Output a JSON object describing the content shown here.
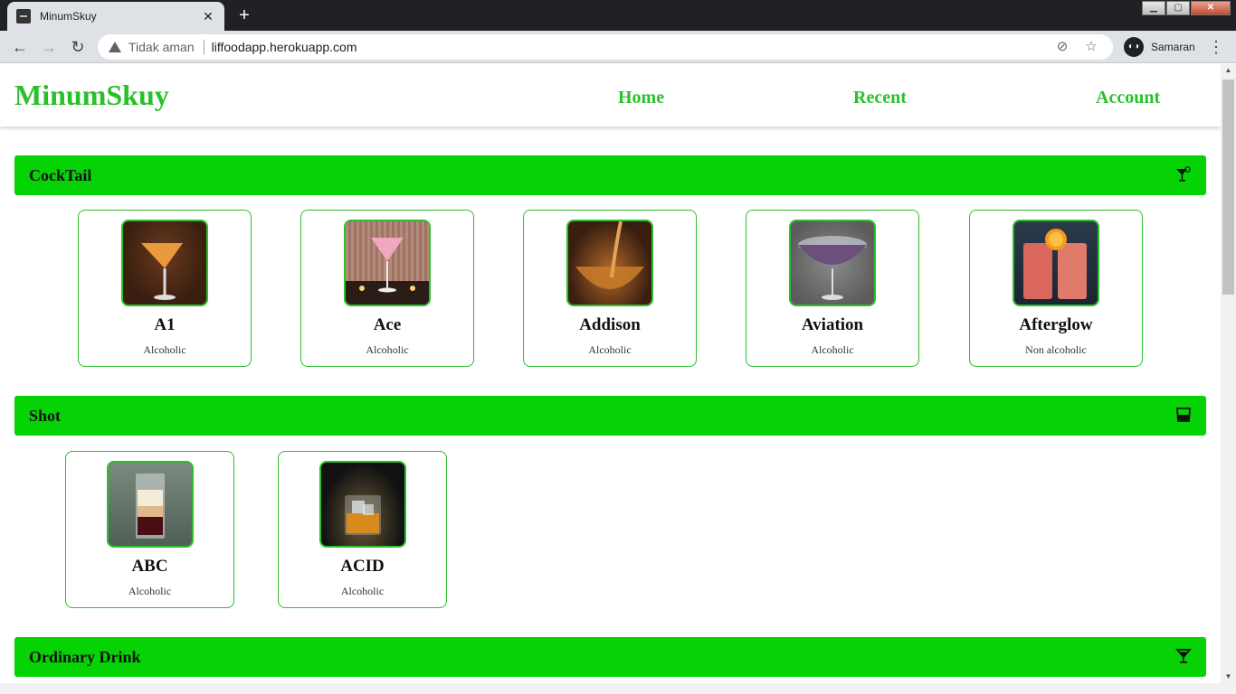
{
  "browser": {
    "tab_title": "MinumSkuy",
    "security_label": "Tidak aman",
    "url": "liffoodapp.herokuapp.com",
    "profile_label": "Samaran"
  },
  "header": {
    "brand": "MinumSkuy",
    "nav": [
      "Home",
      "Recent",
      "Account"
    ]
  },
  "sections": [
    {
      "title": "CockTail",
      "icon": "cocktail-glass-icon",
      "items": [
        {
          "name": "A1",
          "type": "Alcoholic"
        },
        {
          "name": "Ace",
          "type": "Alcoholic"
        },
        {
          "name": "Addison",
          "type": "Alcoholic"
        },
        {
          "name": "Aviation",
          "type": "Alcoholic"
        },
        {
          "name": "Afterglow",
          "type": "Non alcoholic"
        }
      ]
    },
    {
      "title": "Shot",
      "icon": "shot-glass-icon",
      "items": [
        {
          "name": "ABC",
          "type": "Alcoholic"
        },
        {
          "name": "ACID",
          "type": "Alcoholic"
        }
      ]
    },
    {
      "title": "Ordinary Drink",
      "icon": "martini-glass-icon",
      "items": []
    }
  ],
  "colors": {
    "accent": "#2bbf2b",
    "section_bar": "#05d305"
  }
}
